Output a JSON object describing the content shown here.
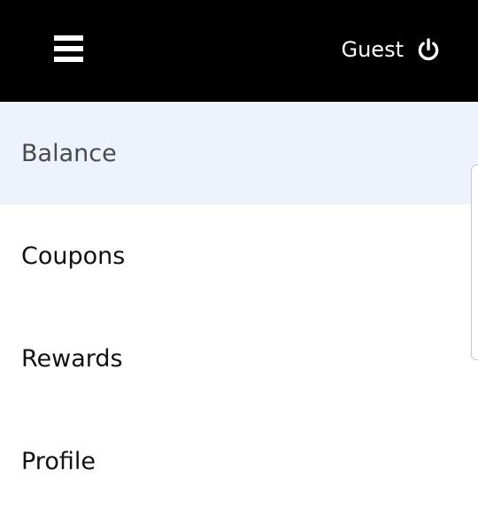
{
  "header": {
    "menu_icon": "hamburger-menu-icon",
    "user_name": "Guest",
    "power_icon": "power-icon",
    "background": "#000000"
  },
  "nav": {
    "active_background": "#eef2fc",
    "items": [
      {
        "label": "Balance",
        "active": true
      },
      {
        "label": "Coupons",
        "active": false
      },
      {
        "label": "Rewards",
        "active": false
      },
      {
        "label": "Profile",
        "active": false
      }
    ]
  }
}
